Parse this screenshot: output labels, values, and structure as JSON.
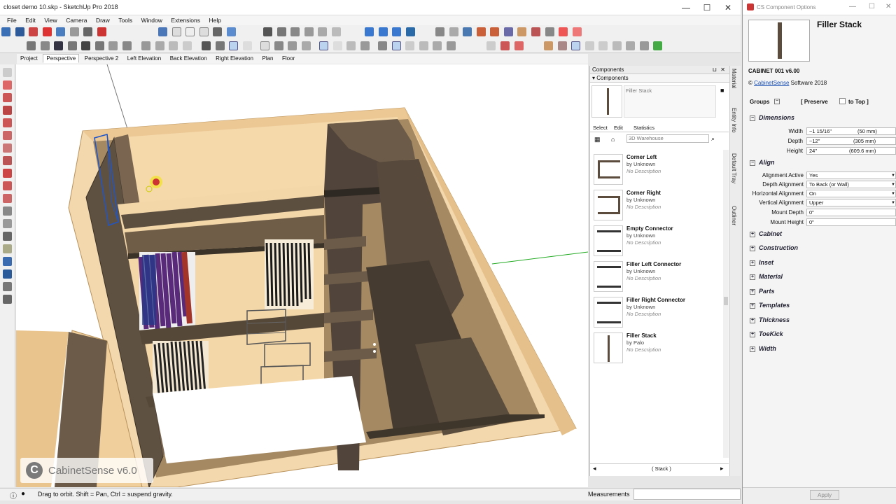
{
  "window": {
    "title": "closet demo 10.skp - SketchUp Pro 2018",
    "minimize": "—",
    "maximize": "☐",
    "close": "✕"
  },
  "menu": [
    "File",
    "Edit",
    "View",
    "Camera",
    "Draw",
    "Tools",
    "Window",
    "Extensions",
    "Help"
  ],
  "scenes": [
    "Project",
    "Perspective",
    "Perspective 2",
    "Left Elevation",
    "Back Elevation",
    "Right Elevation",
    "Plan",
    "Floor"
  ],
  "active_scene": "Perspective",
  "watermark": "CabinetSense v6.0",
  "status": {
    "message": "Drag to orbit. Shift = Pan, Ctrl = suspend gravity.",
    "measurements_label": "Measurements"
  },
  "components": {
    "panel_title": "Components",
    "sub_title": "Components",
    "preview_name": "Filler Stack",
    "tabs": [
      "Select",
      "Edit",
      "Statistics"
    ],
    "search_placeholder": "3D Warehouse",
    "items": [
      {
        "name": "Corner Left",
        "by": "by Unknown",
        "desc": "No Description"
      },
      {
        "name": "Corner Right",
        "by": "by Unknown",
        "desc": "No Description"
      },
      {
        "name": "Empty Connector",
        "by": "by Unknown",
        "desc": "No Description"
      },
      {
        "name": "Filler Left Connector",
        "by": "by Unknown",
        "desc": "No Description"
      },
      {
        "name": "Filler Right Connector",
        "by": "by Unknown",
        "desc": "No Description"
      },
      {
        "name": "Filler Stack",
        "by": "by Palo",
        "desc": "No Description"
      }
    ],
    "footer": "( Stack )"
  },
  "side_tabs": [
    "Material",
    "Entity Info",
    "Default Tray",
    "Outliner"
  ],
  "options": {
    "window_title": "CS Component Options",
    "component_name": "Filler Stack",
    "cabinet": "CABINET 001 v6.00",
    "copyright_prefix": "©",
    "copyright_link": "CabinetSense",
    "copyright_suffix": "Software 2018",
    "groups_label": "Groups",
    "preserve_label": "[ Preserve",
    "totop_label": "to Top ]",
    "dimensions": {
      "title": "Dimensions",
      "width_label": "Width",
      "width_value": "~1 15/16\"",
      "width_mm": "(50 mm)",
      "depth_label": "Depth",
      "depth_value": "~12\"",
      "depth_mm": "(305 mm)",
      "height_label": "Height",
      "height_value": "24\"",
      "height_mm": "(609.6 mm)"
    },
    "align": {
      "title": "Align",
      "fields": [
        {
          "label": "Alignment Active",
          "value": "Yes"
        },
        {
          "label": "Depth Alignment",
          "value": "To Back (or Wall)"
        },
        {
          "label": "Horizontal Alignment",
          "value": "On"
        },
        {
          "label": "Vertical Alignment",
          "value": "Upper"
        },
        {
          "label": "Mount Depth",
          "value": "0\""
        },
        {
          "label": "Mount Height",
          "value": "0\""
        }
      ]
    },
    "sections": [
      "Cabinet",
      "Construction",
      "Inset",
      "Material",
      "Parts",
      "Templates",
      "Thickness",
      "ToeKick",
      "Width"
    ],
    "apply_label": "Apply"
  },
  "colors": {
    "wood": "#5a4d3e",
    "wood_dark": "#3f362b",
    "wall": "#f7ddb4",
    "wall_edge": "#d7b27c",
    "floor": "#ffffff",
    "accent": "#1e55c8"
  }
}
